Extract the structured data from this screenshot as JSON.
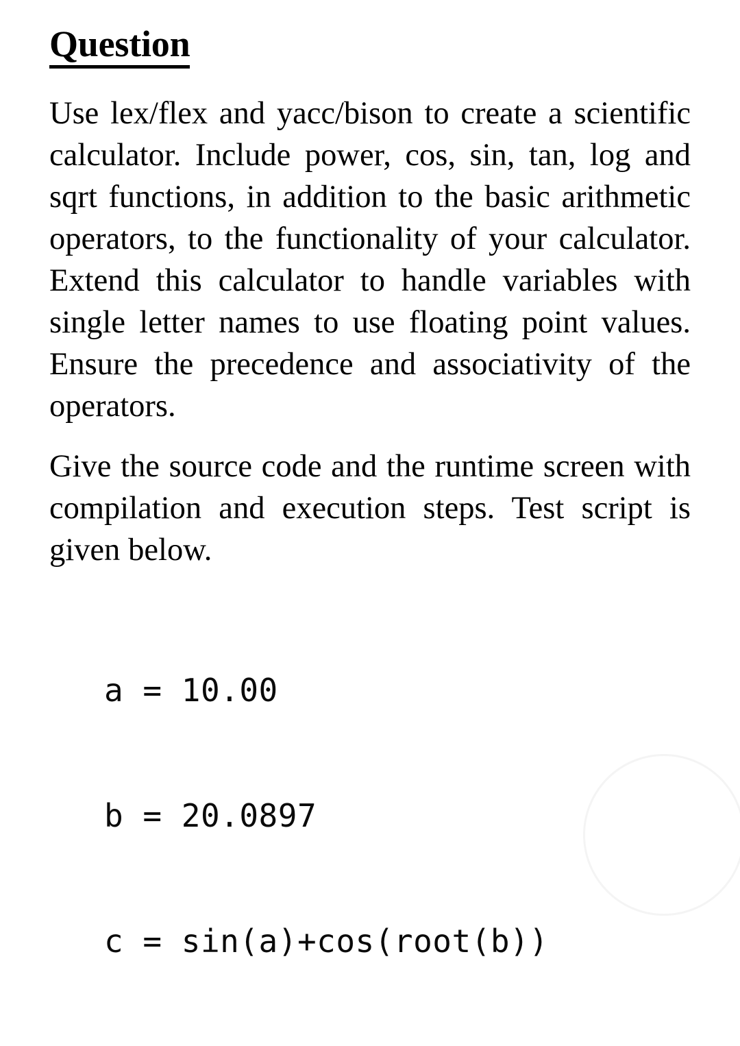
{
  "document": {
    "heading": "Question",
    "paragraphs": [
      "Use lex/flex and yacc/bison to create a scientific calculator. Include power, cos, sin, tan, log and sqrt functions, in addition to the basic arithmetic operators, to the functionality of your calculator. Extend this calculator to handle variables with single letter names to use floating point values. Ensure the precedence and associativity of the operators.",
      "Give the source code and the runtime screen with compilation and execution steps. Test script is given below."
    ],
    "code_block": {
      "lines": [
        "a = 10.00",
        "b = 20.0897",
        "c = sin(a)+cos(root(b))"
      ],
      "line_1": "a = 10.00",
      "line_2": "b = 20.0897",
      "line_3": "c = sin(a)+cos(root(b))"
    },
    "colors": {
      "background": "#ffffff",
      "text": "#000000",
      "watermark": "#f4f4f4"
    }
  }
}
